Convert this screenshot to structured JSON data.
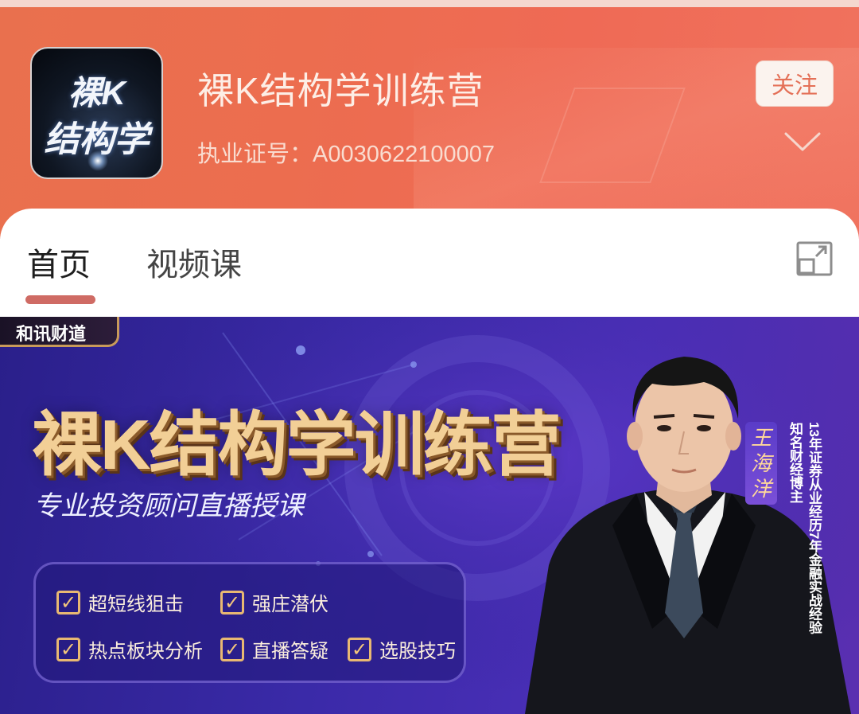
{
  "header": {
    "avatar": {
      "line1": "裸K",
      "line2": "结构学"
    },
    "title": "裸K结构学训练营",
    "license_text": "执业证号：A0030622100007",
    "follow_label": "关注",
    "chevron_icon": "chevron-down-icon"
  },
  "tabs": [
    {
      "label": "首页",
      "active": true
    },
    {
      "label": "视频课",
      "active": false
    }
  ],
  "expand_icon": "expand-icon",
  "banner": {
    "brand_tag": "和讯财道",
    "title": "裸K结构学训练营",
    "subtitle": "专业投资顾问直播授课",
    "features": [
      {
        "label": "超短线狙击",
        "checked": true
      },
      {
        "label": "强庄潜伏",
        "checked": true
      },
      {
        "label": "热点板块分析",
        "checked": true
      },
      {
        "label": "直播答疑",
        "checked": true
      },
      {
        "label": "选股技巧",
        "checked": true
      }
    ],
    "presenter_name": [
      "王",
      "海",
      "洋"
    ],
    "presenter_bio_line1": "13年证券从业经历7年金融实战经验",
    "presenter_bio_line2": "知名财经博主"
  },
  "colors": {
    "header_bg": "#ec6d4f",
    "accent": "#cf6b64",
    "follow_text": "#e47057",
    "banner_bg": "#3a2aa8",
    "banner_title": "#f2cf96"
  }
}
